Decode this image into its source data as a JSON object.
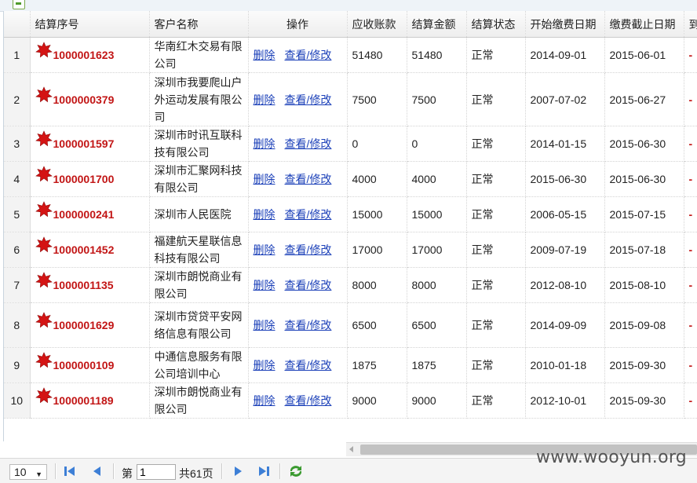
{
  "grid": {
    "columns": [
      "",
      "结算序号",
      "客户名称",
      "操作",
      "应收账款",
      "结算金额",
      "结算状态",
      "开始缴费日期",
      "缴费截止日期",
      "到"
    ],
    "delete_label": "删除",
    "view_label": "查看/修改",
    "rows": [
      {
        "rownum": "1",
        "id": "1000001623",
        "customer": "华南红木交易有限公司",
        "receivable": "51480",
        "amount": "51480",
        "status": "正常",
        "start": "2014-09-01",
        "end": "2015-06-01",
        "extra": "-"
      },
      {
        "rownum": "2",
        "id": "1000000379",
        "customer": "深圳市我要爬山户外运动发展有限公司",
        "receivable": "7500",
        "amount": "7500",
        "status": "正常",
        "start": "2007-07-02",
        "end": "2015-06-27",
        "extra": "-"
      },
      {
        "rownum": "3",
        "id": "1000001597",
        "customer": "深圳市时讯互联科技有限公司",
        "receivable": "0",
        "amount": "0",
        "status": "正常",
        "start": "2014-01-15",
        "end": "2015-06-30",
        "extra": "-"
      },
      {
        "rownum": "4",
        "id": "1000001700",
        "customer": "深圳市汇聚网科技有限公司",
        "receivable": "4000",
        "amount": "4000",
        "status": "正常",
        "start": "2015-06-30",
        "end": "2015-06-30",
        "extra": "-"
      },
      {
        "rownum": "5",
        "id": "1000000241",
        "customer": "深圳市人民医院",
        "receivable": "15000",
        "amount": "15000",
        "status": "正常",
        "start": "2006-05-15",
        "end": "2015-07-15",
        "extra": "-"
      },
      {
        "rownum": "6",
        "id": "1000001452",
        "customer": "福建航天星联信息科技有限公司",
        "receivable": "17000",
        "amount": "17000",
        "status": "正常",
        "start": "2009-07-19",
        "end": "2015-07-18",
        "extra": "-"
      },
      {
        "rownum": "7",
        "id": "1000001135",
        "customer": "深圳市朗悦商业有限公司",
        "receivable": "8000",
        "amount": "8000",
        "status": "正常",
        "start": "2012-08-10",
        "end": "2015-08-10",
        "extra": "-"
      },
      {
        "rownum": "8",
        "id": "1000001629",
        "customer": "深圳市贷贷平安网络信息有限公司",
        "receivable": "6500",
        "amount": "6500",
        "status": "正常",
        "start": "2014-09-09",
        "end": "2015-09-08",
        "extra": "-"
      },
      {
        "rownum": "9",
        "id": "1000000109",
        "customer": "中通信息服务有限公司培训中心",
        "receivable": "1875",
        "amount": "1875",
        "status": "正常",
        "start": "2010-01-18",
        "end": "2015-09-30",
        "extra": "-"
      },
      {
        "rownum": "10",
        "id": "1000001189",
        "customer": "深圳市朗悦商业有限公司",
        "receivable": "9000",
        "amount": "9000",
        "status": "正常",
        "start": "2012-10-01",
        "end": "2015-09-30",
        "extra": "-"
      }
    ]
  },
  "pager": {
    "page_size": "10",
    "page_prefix": "第",
    "current_page": "1",
    "total_label": "共61页"
  },
  "watermark": "www.wooyun.org",
  "colors": {
    "id_text": "#c21515",
    "link": "#1a3fb8",
    "nav_icon": "#3d7fd6",
    "refresh_icon": "#3a9a2f"
  }
}
